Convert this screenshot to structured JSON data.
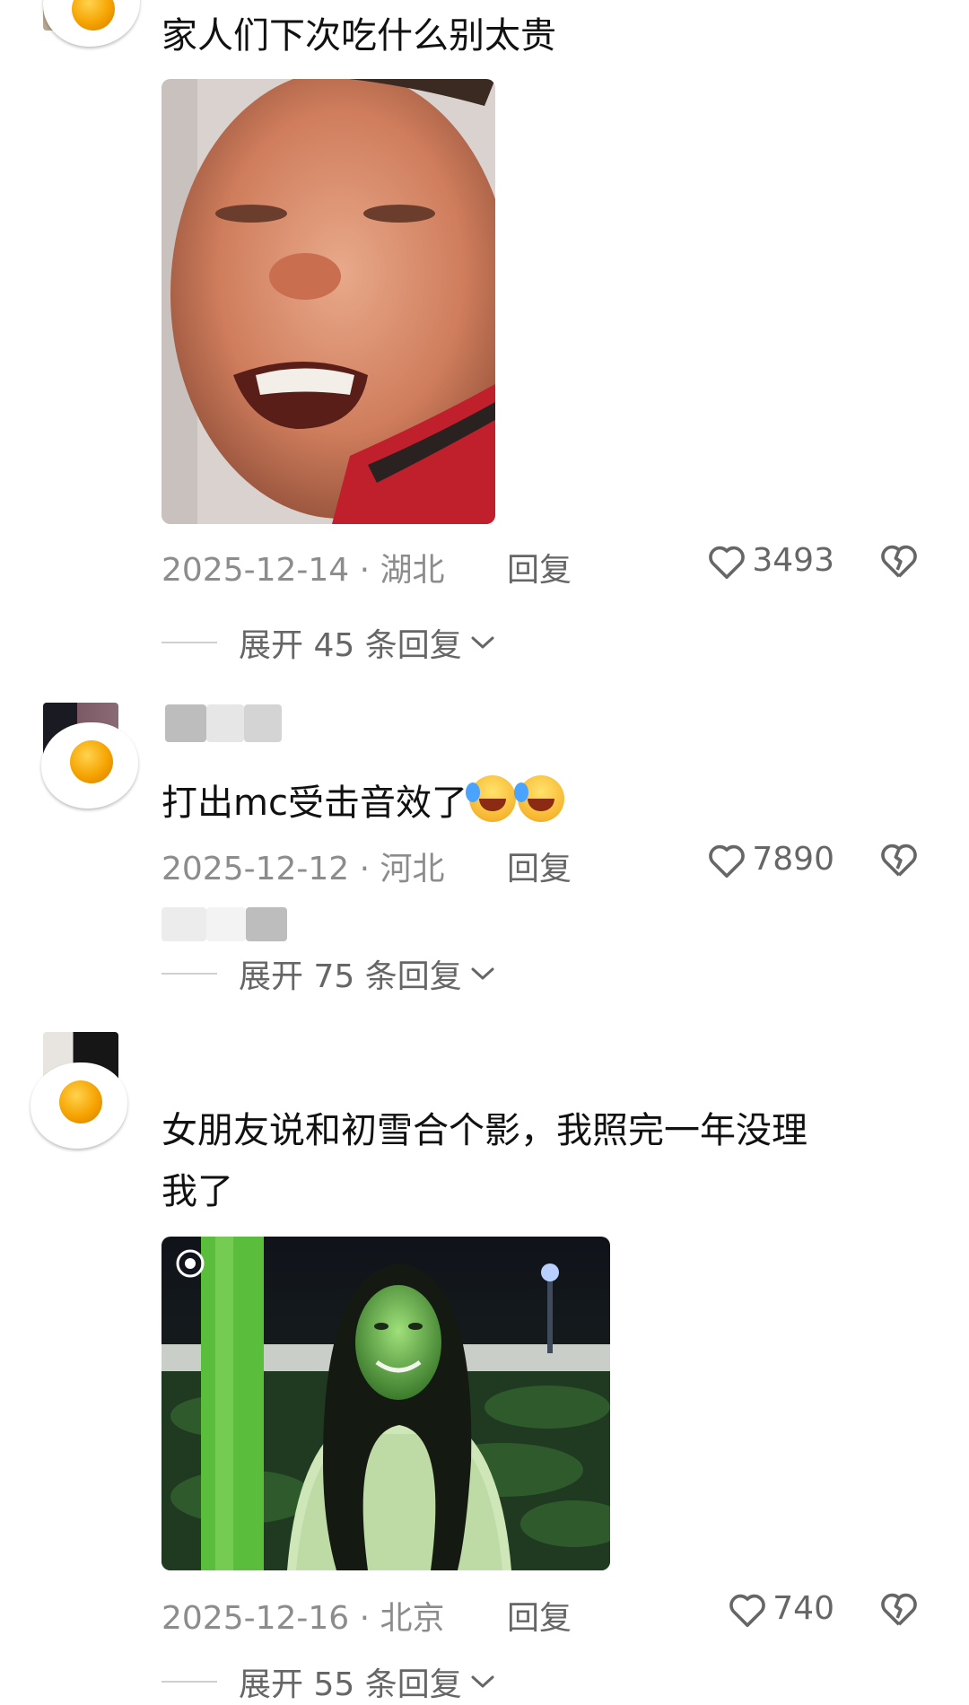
{
  "comments": [
    {
      "text": "家人们下次吃什么别太贵",
      "date_location": "2025-12-14 · 湖北",
      "reply_label": "回复",
      "likes": "3493",
      "expand_label": "展开 45 条回复",
      "has_image": true
    },
    {
      "text": "打出mc受击音效了",
      "date_location": "2025-12-12 · 河北",
      "reply_label": "回复",
      "likes": "7890",
      "expand_label": "展开 75 条回复",
      "emoji": "laughing-crying-face"
    },
    {
      "text_line1": "女朋友说和初雪合个影，我照完一年没理",
      "text_line2": "我了",
      "date_location": "2025-12-16 · 北京",
      "reply_label": "回复",
      "likes": "740",
      "expand_label": "展开 55 条回复",
      "has_image": true
    }
  ],
  "colors": {
    "text_primary": "#111111",
    "text_secondary": "#8c8c8c",
    "background": "#ffffff",
    "photo_green": "#4caf50"
  },
  "icons": [
    "heart-outline-icon",
    "broken-heart-icon",
    "chevron-down-icon",
    "fried-egg-avatar-icon"
  ]
}
